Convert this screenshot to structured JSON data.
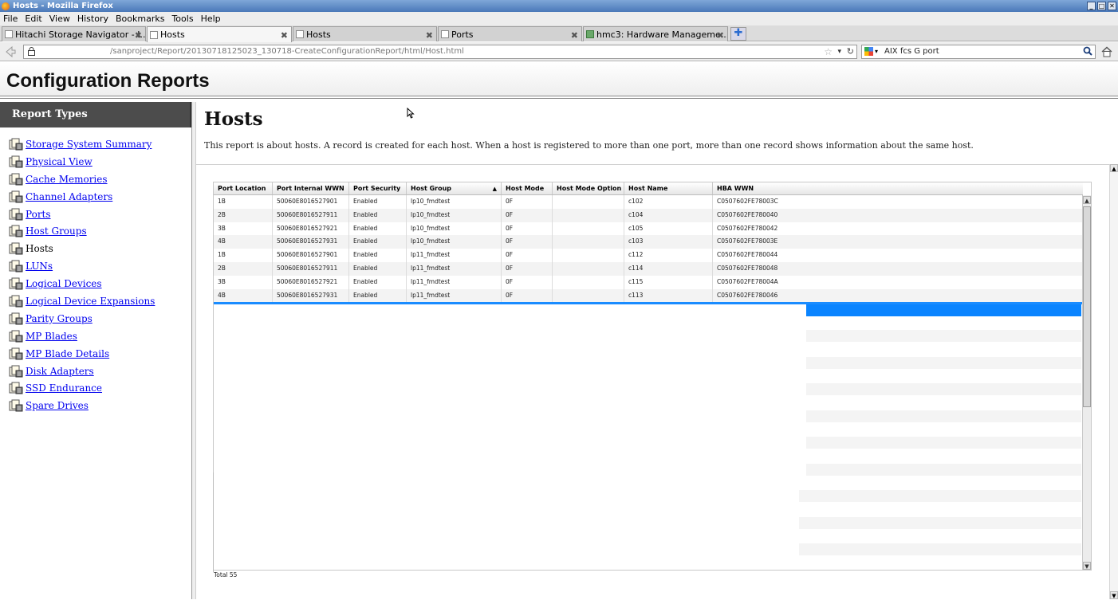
{
  "window": {
    "title": "Hosts - Mozilla Firefox",
    "buttons": [
      "_",
      "□",
      "✕"
    ]
  },
  "menubar": [
    "File",
    "Edit",
    "View",
    "History",
    "Bookmarks",
    "Tools",
    "Help"
  ],
  "tabs": [
    {
      "label": "Hitachi Storage Navigator - I...",
      "close": "✖"
    },
    {
      "label": "Hosts",
      "close": "✖"
    },
    {
      "label": "Hosts",
      "close": "✖"
    },
    {
      "label": "Ports",
      "close": "✖"
    },
    {
      "label": "hmc3: Hardware Manageme...",
      "close": "✖"
    }
  ],
  "newtab": "✚",
  "navbar": {
    "url": "/sanproject/Report/20130718125023_130718-CreateConfigurationReport/html/Host.html",
    "search_value": "AIX fcs G port"
  },
  "page": {
    "header_title": "Configuration Reports"
  },
  "sidebar": {
    "heading": "Report Types",
    "items": [
      {
        "label": "Storage System Summary",
        "link": true
      },
      {
        "label": "Physical View",
        "link": true
      },
      {
        "label": "Cache Memories",
        "link": true
      },
      {
        "label": "Channel Adapters",
        "link": true
      },
      {
        "label": "Ports",
        "link": true
      },
      {
        "label": "Host Groups",
        "link": true
      },
      {
        "label": "Hosts",
        "link": false
      },
      {
        "label": "LUNs",
        "link": true
      },
      {
        "label": "Logical Devices",
        "link": true
      },
      {
        "label": "Logical Device Expansions",
        "link": true
      },
      {
        "label": "Parity Groups",
        "link": true
      },
      {
        "label": "MP Blades",
        "link": true
      },
      {
        "label": "MP Blade Details",
        "link": true
      },
      {
        "label": "Disk Adapters",
        "link": true
      },
      {
        "label": "SSD Endurance",
        "link": true
      },
      {
        "label": "Spare Drives",
        "link": true
      }
    ]
  },
  "main": {
    "title": "Hosts",
    "description": "This report is about hosts. A record is created for each host. When a host is registered to more than one port, more than one record shows information about the same host.",
    "table": {
      "columns": [
        "Port Location",
        "Port Internal WWN",
        "Port Security",
        "Host Group",
        "Host Mode",
        "Host Mode Option",
        "Host Name",
        "HBA WWN"
      ],
      "sorted_column": "Host Group",
      "sort_glyph": "▲",
      "rows": [
        [
          "1B",
          "50060E8016527901",
          "Enabled",
          "lp10_fmdtest",
          "0F",
          "",
          "c102",
          "C0507602FE78003C"
        ],
        [
          "2B",
          "50060E8016527911",
          "Enabled",
          "lp10_fmdtest",
          "0F",
          "",
          "c104",
          "C0507602FE780040"
        ],
        [
          "3B",
          "50060E8016527921",
          "Enabled",
          "lp10_fmdtest",
          "0F",
          "",
          "c105",
          "C0507602FE780042"
        ],
        [
          "4B",
          "50060E8016527931",
          "Enabled",
          "lp10_fmdtest",
          "0F",
          "",
          "c103",
          "C0507602FE78003E"
        ],
        [
          "1B",
          "50060E8016527901",
          "Enabled",
          "lp11_fmdtest",
          "0F",
          "",
          "c112",
          "C0507602FE780044"
        ],
        [
          "2B",
          "50060E8016527911",
          "Enabled",
          "lp11_fmdtest",
          "0F",
          "",
          "c114",
          "C0507602FE780048"
        ],
        [
          "3B",
          "50060E8016527921",
          "Enabled",
          "lp11_fmdtest",
          "0F",
          "",
          "c115",
          "C0507602FE78004A"
        ],
        [
          "4B",
          "50060E8016527931",
          "Enabled",
          "lp11_fmdtest",
          "0F",
          "",
          "c113",
          "C0507602FE780046"
        ]
      ],
      "total": "Total 55"
    }
  },
  "colors": {
    "link": "#0000ee",
    "sidebar_header_bg": "#4c4c4c",
    "selection_blue": "#0a84ff"
  }
}
